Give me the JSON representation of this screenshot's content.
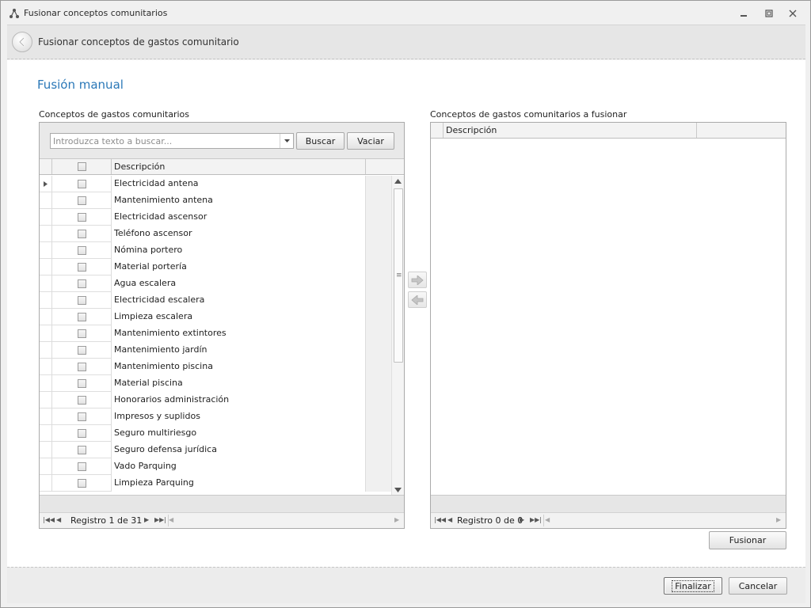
{
  "window": {
    "title": "Fusionar conceptos comunitarios",
    "icons": {
      "app": "network-nodes-icon",
      "minimize": "minimize-icon",
      "restore": "restore-icon",
      "close": "close-icon"
    }
  },
  "header": {
    "title": "Fusionar conceptos de gastos comunitario",
    "back_icon": "back-arrow-icon"
  },
  "main": {
    "section_title": "Fusión manual"
  },
  "left_panel": {
    "label": "Conceptos de gastos comunitarios",
    "search": {
      "placeholder": "Introduzca texto a buscar...",
      "value": ""
    },
    "buscar_label": "Buscar",
    "vaciar_label": "Vaciar",
    "columns": [
      "Descripción"
    ],
    "rows": [
      "Electricidad antena",
      "Mantenimiento antena",
      "Electricidad ascensor",
      "Teléfono ascensor",
      "Nómina portero",
      "Material portería",
      "Agua escalera",
      "Electricidad escalera",
      "Limpieza escalera",
      "Mantenimiento extintores",
      "Mantenimiento jardín",
      "Mantenimiento piscina",
      "Material piscina",
      "Honorarios administración",
      "Impresos y suplidos",
      "Seguro multiriesgo",
      "Seguro defensa jurídica",
      "Vado Parquing",
      "Limpieza Parquing"
    ],
    "navigator": {
      "text": "Registro 1 de 31"
    }
  },
  "right_panel": {
    "label": "Conceptos de gastos comunitarios a fusionar",
    "columns": [
      "Descripción"
    ],
    "navigator": {
      "text": "Registro 0 de 0"
    }
  },
  "transfer": {
    "add_icon": "arrow-right-icon",
    "remove_icon": "arrow-left-icon"
  },
  "actions": {
    "fusionar_label": "Fusionar",
    "finalizar_label": "Finalizar",
    "cancelar_label": "Cancelar"
  },
  "colors": {
    "accent": "#2b78b8",
    "border": "#aaaaaa",
    "background": "#f0f0f0"
  }
}
